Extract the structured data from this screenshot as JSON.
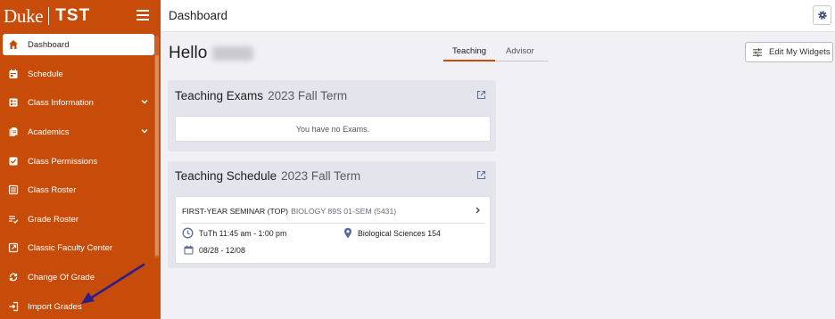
{
  "brand": {
    "name": "Duke",
    "product": "TST"
  },
  "sidebar": {
    "items": [
      {
        "label": "Dashboard",
        "icon": "home-icon"
      },
      {
        "label": "Schedule",
        "icon": "calendar-icon"
      },
      {
        "label": "Class Information",
        "icon": "class-info-icon"
      },
      {
        "label": "Academics",
        "icon": "documents-icon"
      },
      {
        "label": "Class Permissions",
        "icon": "checkbox-icon"
      },
      {
        "label": "Class Roster",
        "icon": "roster-icon"
      },
      {
        "label": "Grade Roster",
        "icon": "grade-list-icon"
      },
      {
        "label": "Classic Faculty Center",
        "icon": "external-link-icon"
      },
      {
        "label": "Change Of Grade",
        "icon": "change-icon"
      },
      {
        "label": "Import Grades",
        "icon": "import-icon"
      }
    ]
  },
  "header": {
    "title": "Dashboard"
  },
  "greeting": {
    "text": "Hello"
  },
  "tabs": [
    {
      "label": "Teaching"
    },
    {
      "label": "Advisor"
    }
  ],
  "edit_widgets": {
    "label": "Edit My Widgets"
  },
  "exams_card": {
    "title": "Teaching Exams",
    "term": "2023 Fall Term",
    "empty": "You have no Exams."
  },
  "schedule_card": {
    "title": "Teaching Schedule",
    "term": "2023 Fall Term",
    "course": {
      "name": "FIRST-YEAR SEMINAR (TOP)",
      "code": "BIOLOGY 89S 01-SEM (5431)",
      "time": "TuTh 11:45 am - 1:00 pm",
      "location": "Biological Sciences 154",
      "dates": "08/28 - 12/08"
    }
  },
  "colors": {
    "accent": "#c84c09",
    "background": "#f0f0f5",
    "card": "#e3e4ec",
    "arrow": "#2d1f8a"
  }
}
